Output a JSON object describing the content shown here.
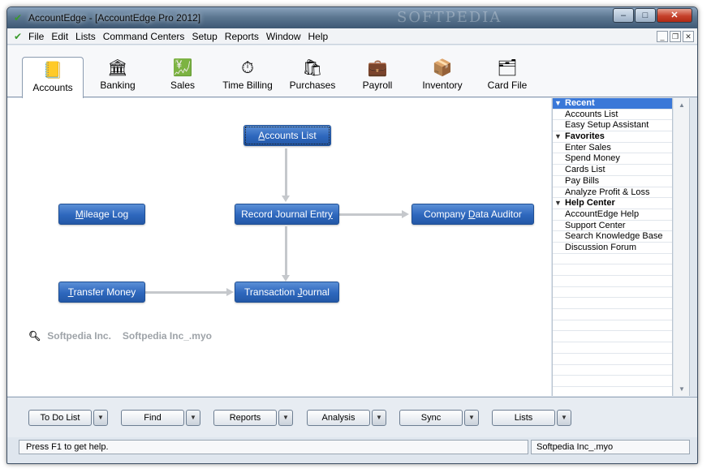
{
  "window": {
    "title": "AccountEdge - [AccountEdge Pro 2012]",
    "watermark": "SOFTPEDIA",
    "caption_buttons": {
      "minimize": "–",
      "maximize": "□",
      "close": "✕"
    },
    "mdi_buttons": {
      "minimize": "_",
      "restore": "❐",
      "close": "✕"
    }
  },
  "menu": {
    "items": [
      "File",
      "Edit",
      "Lists",
      "Command Centers",
      "Setup",
      "Reports",
      "Window",
      "Help"
    ]
  },
  "tabs": [
    {
      "label": "Accounts",
      "icon": "accounts-ledger-icon",
      "glyph": "📒",
      "active": true
    },
    {
      "label": "Banking",
      "icon": "bank-icon",
      "glyph": "🏛",
      "active": false
    },
    {
      "label": "Sales",
      "icon": "sales-register-icon",
      "glyph": "💹",
      "active": false
    },
    {
      "label": "Time Billing",
      "icon": "stopwatch-icon",
      "glyph": "⏱",
      "active": false
    },
    {
      "label": "Purchases",
      "icon": "purchase-bag-icon",
      "glyph": "🛍",
      "active": false
    },
    {
      "label": "Payroll",
      "icon": "payroll-briefcase-icon",
      "glyph": "💼",
      "active": false
    },
    {
      "label": "Inventory",
      "icon": "hand-truck-icon",
      "glyph": "📦",
      "active": false
    },
    {
      "label": "Card File",
      "icon": "card-file-icon",
      "glyph": "🗂",
      "active": false
    }
  ],
  "flow": {
    "accounts_list": {
      "pre": "",
      "key": "A",
      "post": "ccounts List"
    },
    "mileage_log": {
      "pre": "",
      "key": "M",
      "post": "ileage Log"
    },
    "record_journal": {
      "pre": "Record Journal Entr",
      "key": "y",
      "post": ""
    },
    "data_auditor": {
      "pre": "Company ",
      "key": "D",
      "post": "ata Auditor"
    },
    "transfer_money": {
      "pre": "",
      "key": "T",
      "post": "ransfer Money"
    },
    "transaction_journal": {
      "pre": "Transaction ",
      "key": "J",
      "post": "ournal"
    }
  },
  "company": {
    "name": "Softpedia Inc.",
    "file": "Softpedia Inc_.myo"
  },
  "sidebar": {
    "recent_header": "Recent",
    "recent": [
      "Accounts List",
      "Easy Setup Assistant"
    ],
    "favorites_header": "Favorites",
    "favorites": [
      "Enter Sales",
      "Spend Money",
      "Cards List",
      "Pay Bills",
      "Analyze Profit & Loss"
    ],
    "help_header": "Help Center",
    "help": [
      "AccountEdge Help",
      "Support Center",
      "Search Knowledge Base",
      "Discussion Forum"
    ]
  },
  "bottom_buttons": [
    "To Do List",
    "Find",
    "Reports",
    "Analysis",
    "Sync",
    "Lists"
  ],
  "status": {
    "left": "Press F1 to get help.",
    "right": "Softpedia Inc_.myo"
  }
}
